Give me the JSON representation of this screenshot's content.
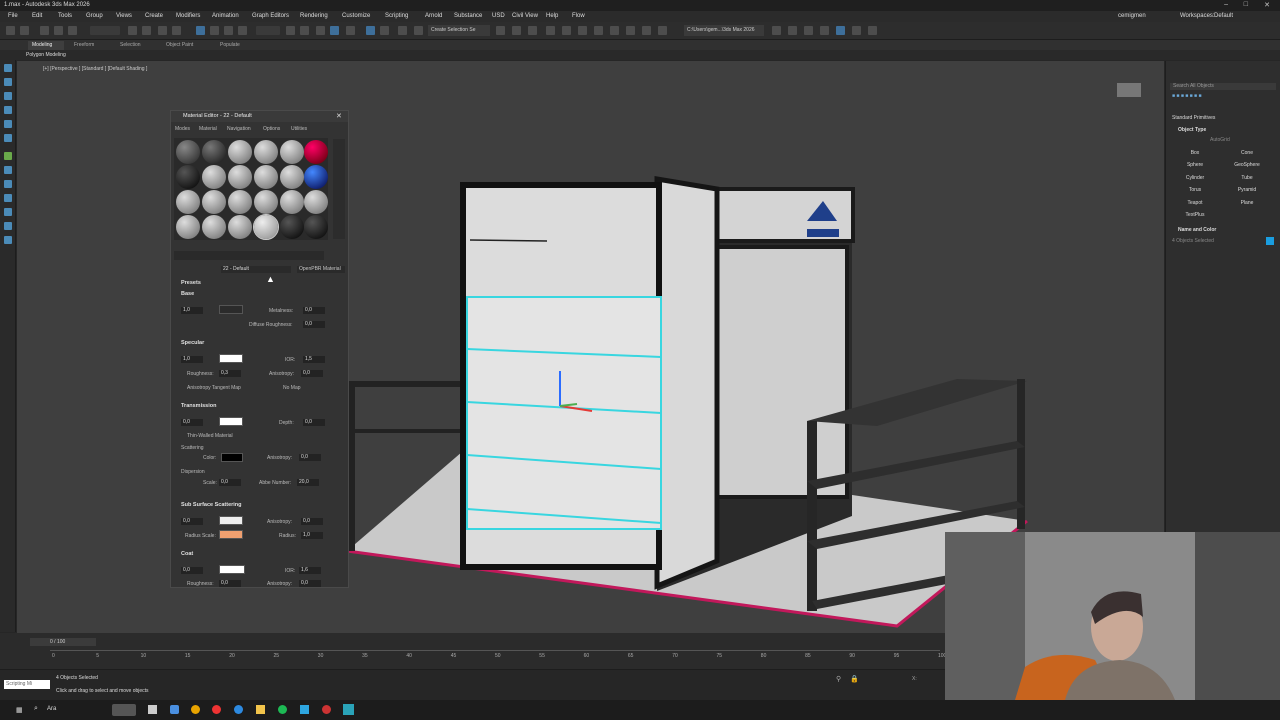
{
  "window": {
    "title": "1.max - Autodesk 3ds Max 2026"
  },
  "menu": [
    "File",
    "Edit",
    "Tools",
    "Group",
    "Views",
    "Create",
    "Modifiers",
    "Animation",
    "Graph Editors",
    "Rendering",
    "Customize",
    "Scripting",
    "Arnold",
    "Substance",
    "USD",
    "Civil View",
    "Help",
    "Flow"
  ],
  "user": {
    "name": "cemigmen",
    "workspaces_label": "Workspaces:",
    "workspace": "Default"
  },
  "toolbar": {
    "selection_set": "Create Selection Se",
    "path": "C:\\Users\\gem...\\3ds Max 2026"
  },
  "ribbon": {
    "tabs": [
      "Modeling",
      "Freeform",
      "Selection",
      "Object Paint",
      "Populate"
    ],
    "subtab": "Polygon Modeling"
  },
  "viewport": {
    "label": "[+] [Perspective ] [Standard ] [Default Shading ]"
  },
  "material_editor": {
    "title": "Material Editor - 22 - Default",
    "menu": [
      "Modes",
      "Material",
      "Navigation",
      "Options",
      "Utilities"
    ],
    "material_name": "22 - Default",
    "material_type": "OpenPBR Material",
    "sections": {
      "presets": "Presets",
      "base": {
        "label": "Base",
        "weight": "1,0",
        "metalness_label": "Metalness:",
        "metalness": "0,0",
        "diffuse_roughness_label": "Diffuse Roughness:",
        "diffuse_roughness": "0,0"
      },
      "specular": {
        "label": "Specular",
        "weight": "1,0",
        "ior_label": "IOR:",
        "ior": "1,5",
        "roughness_label": "Roughness:",
        "roughness": "0,3",
        "anisotropy_label": "Anisotropy:",
        "anisotropy": "0,0",
        "tangent_label": "Anisotropy Tangent Map",
        "no_map": "No Map"
      },
      "transmission": {
        "label": "Transmission",
        "weight": "0,0",
        "depth_label": "Depth:",
        "depth": "0,0",
        "thin_walled": "Thin-Walled Material",
        "scattering": "Scattering",
        "color_label": "Color:",
        "anisotropy_label": "Anisotropy:",
        "anisotropy": "0,0",
        "dispersion": "Dispersion",
        "scale_label": "Scale:",
        "scale": "0,0",
        "abbe_label": "Abbe Number:",
        "abbe": "20,0"
      },
      "sss": {
        "label": "Sub Surface Scattering",
        "weight": "0,0",
        "anisotropy_label": "Anisotropy:",
        "anisotropy": "0,0",
        "radius_scale_label": "Radius Scale:",
        "radius_label": "Radius:",
        "radius": "1,0"
      },
      "coat": {
        "label": "Coat",
        "weight": "0,0",
        "ior_label": "IOR:",
        "ior": "1,6",
        "roughness_label": "Roughness:",
        "roughness": "0,0",
        "anisotropy_label": "Anisotropy:",
        "anisotropy": "0,0"
      }
    }
  },
  "command_panel": {
    "search_placeholder": "Search All Objects",
    "category": "Standard Primitives",
    "object_type_header": "Object Type",
    "autogrid": "AutoGrid",
    "buttons": [
      "Box",
      "Cone",
      "Sphere",
      "GeoSphere",
      "Cylinder",
      "Tube",
      "Torus",
      "Pyramid",
      "Teapot",
      "Plane",
      "TextPlus"
    ],
    "name_color_header": "Name and Color",
    "name_value": "4 Objects Selected",
    "color": "#1a9ee0"
  },
  "timeline": {
    "frame": "0 / 100",
    "ticks": [
      "0",
      "5",
      "10",
      "15",
      "20",
      "25",
      "30",
      "35",
      "40",
      "45",
      "50",
      "55",
      "60",
      "65",
      "70",
      "75",
      "80",
      "85",
      "90",
      "95",
      "100"
    ]
  },
  "status": {
    "selected": "4 Objects Selected",
    "hint": "Click and drag to select and move objects",
    "maxscript": "Scripting Mi",
    "x_label": "X:"
  },
  "taskbar": {
    "search": "Ara"
  },
  "colors": {
    "accent": "#3e6f9a",
    "selection": "#38d6e0",
    "floor_edge": "#c2185b"
  }
}
